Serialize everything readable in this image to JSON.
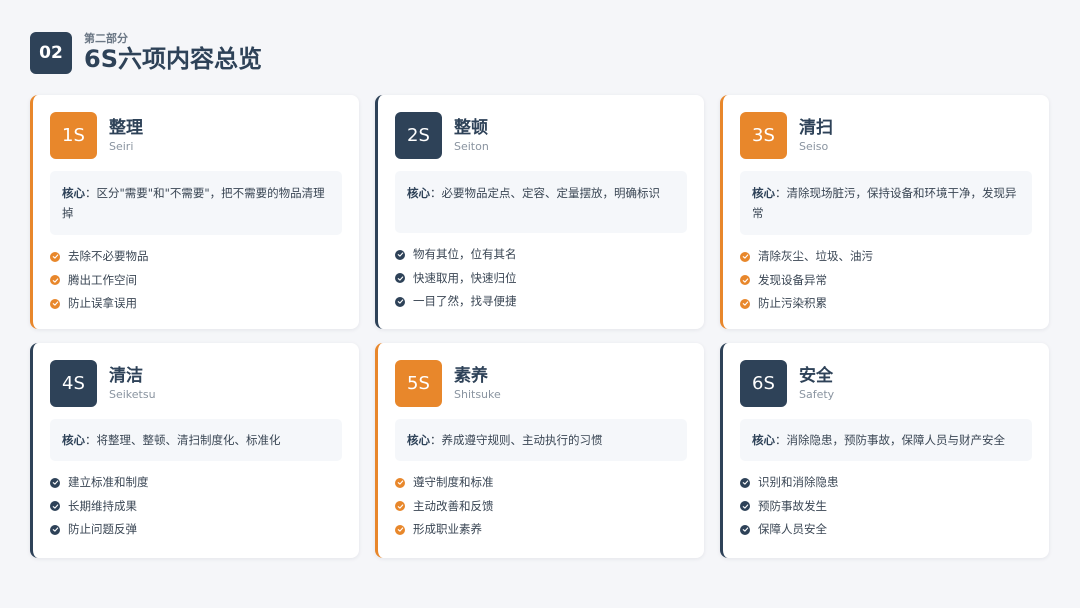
{
  "header": {
    "section_number": "02",
    "section_label": "第二部分",
    "title": "6S六项内容总览"
  },
  "core_prefix": "核心",
  "cards": [
    {
      "badge": "1S",
      "name": "整理",
      "roman": "Seiri",
      "accent": "#e8872b",
      "core": "：区分\"需要\"和\"不需要\"，把不需要的物品清理掉",
      "points": [
        "去除不必要物品",
        "腾出工作空间",
        "防止误拿误用"
      ]
    },
    {
      "badge": "2S",
      "name": "整顿",
      "roman": "Seiton",
      "accent": "#2e4258",
      "core": "：必要物品定点、定容、定量摆放，明确标识",
      "points": [
        "物有其位，位有其名",
        "快速取用，快速归位",
        "一目了然，找寻便捷"
      ]
    },
    {
      "badge": "3S",
      "name": "清扫",
      "roman": "Seiso",
      "accent": "#e8872b",
      "core": "：清除现场脏污，保持设备和环境干净，发现异常",
      "points": [
        "清除灰尘、垃圾、油污",
        "发现设备异常",
        "防止污染积累"
      ]
    },
    {
      "badge": "4S",
      "name": "清洁",
      "roman": "Seiketsu",
      "accent": "#2e4258",
      "core": "：将整理、整顿、清扫制度化、标准化",
      "points": [
        "建立标准和制度",
        "长期维持成果",
        "防止问题反弹"
      ]
    },
    {
      "badge": "5S",
      "name": "素养",
      "roman": "Shitsuke",
      "accent": "#e8872b",
      "core": "：养成遵守规则、主动执行的习惯",
      "points": [
        "遵守制度和标准",
        "主动改善和反馈",
        "形成职业素养"
      ]
    },
    {
      "badge": "6S",
      "name": "安全",
      "roman": "Safety",
      "accent": "#2e4258",
      "core": "：消除隐患，预防事故，保障人员与财产安全",
      "points": [
        "识别和消除隐患",
        "预防事故发生",
        "保障人员安全"
      ]
    }
  ]
}
